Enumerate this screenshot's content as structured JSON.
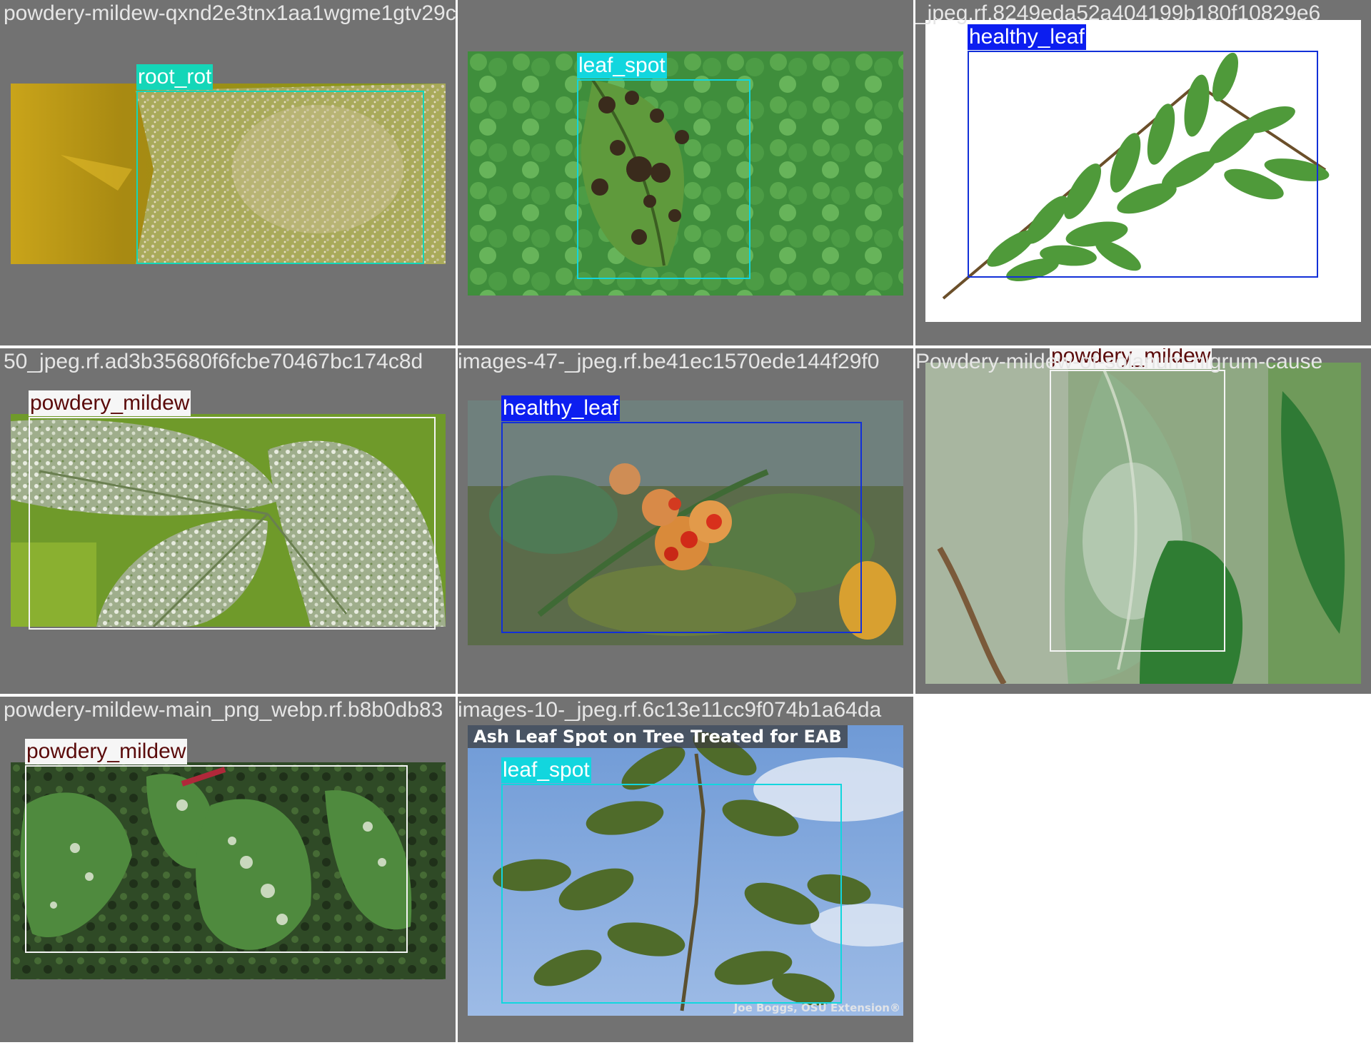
{
  "tiles": [
    {
      "filename": "powdery-mildew-qxnd2e3tnx1aa1wgme1gtv29cjpeg.rf.d32614d043e74d2a6024e8dbc696",
      "labels": [
        "root_rot"
      ]
    },
    {
      "filename": "",
      "labels": [
        "leaf_spot"
      ]
    },
    {
      "filename": "_jpeg.rf.8249eda52a404199b180f10829e6",
      "labels": [
        "healthy_leaf"
      ]
    },
    {
      "filename": "50_jpeg.rf.ad3b35680f6fcbe70467bc174c8d",
      "labels": [
        "powdery_mildew"
      ]
    },
    {
      "filename": "images-47-_jpeg.rf.be41ec1570ede144f29f0",
      "labels": [
        "healthy_leaf"
      ]
    },
    {
      "filename": "Powdery-mildew-of-solanum-nigrum-cause",
      "labels": [
        "powdery_mildew"
      ]
    },
    {
      "filename": "powdery-mildew-main_png_webp.rf.b8b0db83",
      "labels": [
        "powdery_mildew"
      ]
    },
    {
      "filename": "images-10-_jpeg.rf.6c13e11cc9f074b1a64da",
      "labels": [
        "leaf_spot"
      ],
      "image_caption": "Ash Leaf Spot on Tree Treated for EAB",
      "image_credit": "Joe Boggs, OSU Extension®"
    }
  ],
  "colors": {
    "root_rot": "#14d6b8",
    "leaf_spot": "#12d6de",
    "healthy_leaf": "#0c1ef0",
    "powdery_mildew": "#f6f6f6",
    "tile_background": "#727272"
  }
}
